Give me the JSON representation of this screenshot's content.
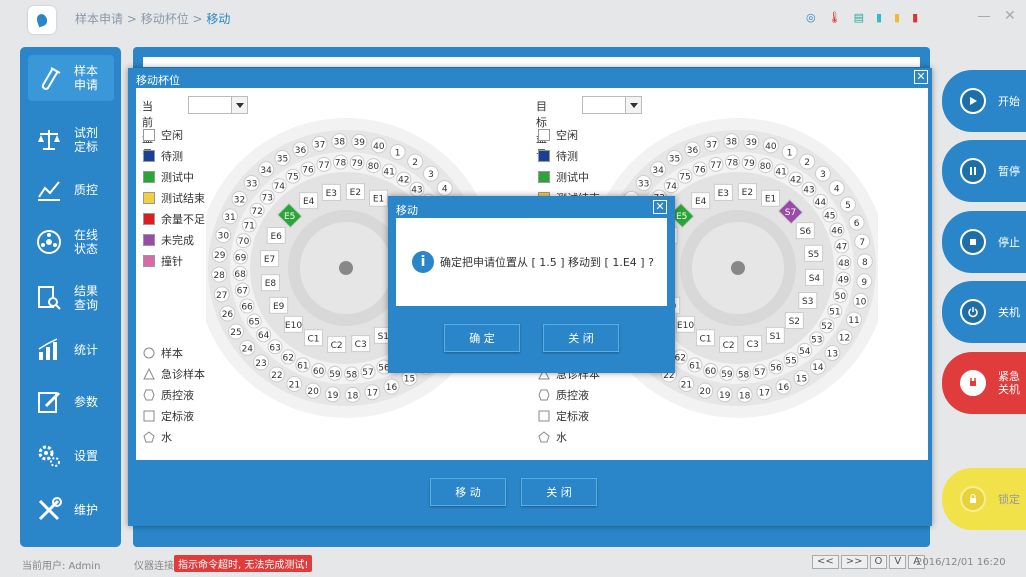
{
  "breadcrumb": {
    "a": "样本申请",
    "sep1": " > ",
    "b": "移动杯位",
    "sep2": " > ",
    "c": "移动"
  },
  "sidebar": {
    "items": [
      {
        "label": "样本\n申请",
        "icon": "sample-tube-icon"
      },
      {
        "label": "试剂\n定标",
        "icon": "balance-icon"
      },
      {
        "label": "质控",
        "icon": "chart-line-icon"
      },
      {
        "label": "在线\n状态",
        "icon": "disc-icon"
      },
      {
        "label": "结果\n查询",
        "icon": "search-doc-icon"
      },
      {
        "label": "统计",
        "icon": "bar-chart-icon"
      },
      {
        "label": "参数",
        "icon": "edit-icon"
      },
      {
        "label": "设置",
        "icon": "gear-icon"
      },
      {
        "label": "维护",
        "icon": "wrench-icon"
      }
    ]
  },
  "right": {
    "start": "开始",
    "pause": "暂停",
    "stop": "停止",
    "shutdown": "关机",
    "emergency": "紧急\n关机",
    "lock": "锁定"
  },
  "dialog": {
    "title": "移动杯位",
    "current_label": "当前盘号",
    "target_label": "目标盘号",
    "legend": [
      "空闲",
      "待测",
      "测试中",
      "测试结束",
      "余量不足",
      "未完成",
      "撞针"
    ],
    "legend_colors": [
      "#ffffff",
      "#1b3f95",
      "#2aa538",
      "#f0d040",
      "#d92020",
      "#9a4aa8",
      "#d96aa8"
    ],
    "shapes": [
      "样本",
      "急诊样本",
      "质控液",
      "定标液",
      "水"
    ],
    "move_btn": "移 动",
    "close_btn": "关 闭"
  },
  "plates": {
    "outer": [
      "1",
      "2",
      "3",
      "4",
      "5",
      "6",
      "7",
      "8",
      "9",
      "10",
      "11",
      "12",
      "13",
      "14",
      "15",
      "16",
      "17",
      "18",
      "19",
      "20",
      "21",
      "22",
      "23",
      "24",
      "25",
      "26",
      "27",
      "28",
      "29",
      "30",
      "31",
      "32",
      "33",
      "34",
      "35",
      "36",
      "37",
      "38",
      "39",
      "40"
    ],
    "middle": [
      "41",
      "42",
      "43",
      "44",
      "45",
      "46",
      "47",
      "48",
      "49",
      "50",
      "51",
      "52",
      "53",
      "54",
      "55",
      "56",
      "57",
      "58",
      "59",
      "60",
      "61",
      "62",
      "63",
      "64",
      "65",
      "66",
      "67",
      "68",
      "69",
      "70",
      "71",
      "72",
      "73",
      "74",
      "75",
      "76",
      "77",
      "78",
      "79",
      "80"
    ],
    "inner": [
      "E1",
      "E2",
      "E3",
      "E4",
      "E5",
      "E6",
      "E7",
      "E8",
      "E9",
      "E10",
      "C1",
      "C2",
      "C3",
      "S1",
      "S2",
      "S3",
      "S4",
      "S5",
      "S6",
      "S7"
    ]
  },
  "confirm": {
    "title": "移动",
    "message": "确定把申请位置从 [ 1.5 ] 移动到 [ 1.E4 ] ?",
    "ok": "确 定",
    "close": "关 闭"
  },
  "status": {
    "user": "当前用户:  Admin",
    "conn": "仪器连接",
    "error": "指示命令超时, 无法完成测试!",
    "nav": [
      "<<",
      ">>",
      "O",
      "V",
      "A"
    ],
    "datetime": "2016/12/01 16:20"
  }
}
